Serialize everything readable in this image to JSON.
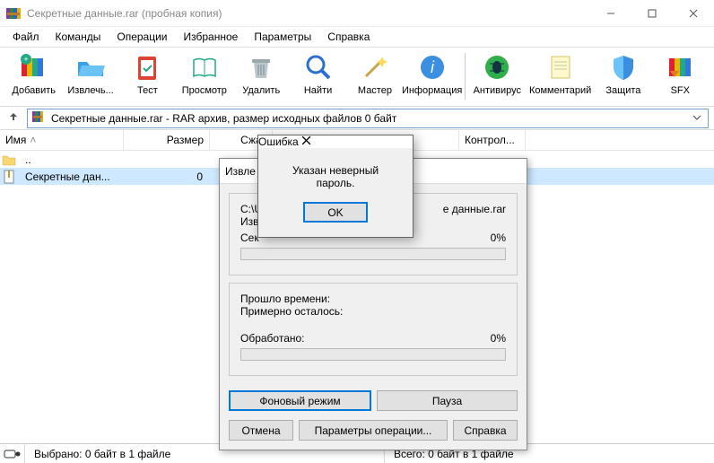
{
  "window": {
    "title": "Секретные данные.rar (пробная копия)"
  },
  "menus": {
    "file": "Файл",
    "commands": "Команды",
    "operations": "Операции",
    "favorites": "Избранное",
    "options": "Параметры",
    "help": "Справка"
  },
  "toolbar": {
    "add": "Добавить",
    "extract": "Извлечь...",
    "test": "Тест",
    "view": "Просмотр",
    "delete": "Удалить",
    "find": "Найти",
    "wizard": "Мастер",
    "info": "Информация",
    "antivirus": "Антивирус",
    "comment": "Комментарий",
    "protect": "Защита",
    "sfx": "SFX"
  },
  "address": {
    "up_icon": "↥",
    "path": "Секретные данные.rar - RAR архив, размер исходных файлов 0 байт"
  },
  "columns": {
    "name": "Имя",
    "size": "Размер",
    "packed": "Сжат",
    "control": "Контрол..."
  },
  "rows": {
    "up": "..",
    "item1_name": "Секретные дан...",
    "item1_size": "0"
  },
  "status": {
    "selected": "Выбрано: 0 байт в 1 файле",
    "total": "Всего: 0 байт в 1 файле"
  },
  "extractDialog": {
    "title": "Извле",
    "path_fragment_left": "C:\\U",
    "path_fragment_right": "е данные.rar",
    "line2_left": "Изв",
    "line3_left": "Сек",
    "pct1": "0%",
    "elapsed": "Прошло времени:",
    "remaining": "Примерно осталось:",
    "processed": "Обработано:",
    "pct2": "0%",
    "bg_mode": "Фоновый режим",
    "pause": "Пауза",
    "cancel": "Отмена",
    "op_params": "Параметры операции...",
    "help": "Справка"
  },
  "errorDialog": {
    "title": "Ошибка",
    "message": "Указан неверный пароль.",
    "ok": "OK"
  }
}
